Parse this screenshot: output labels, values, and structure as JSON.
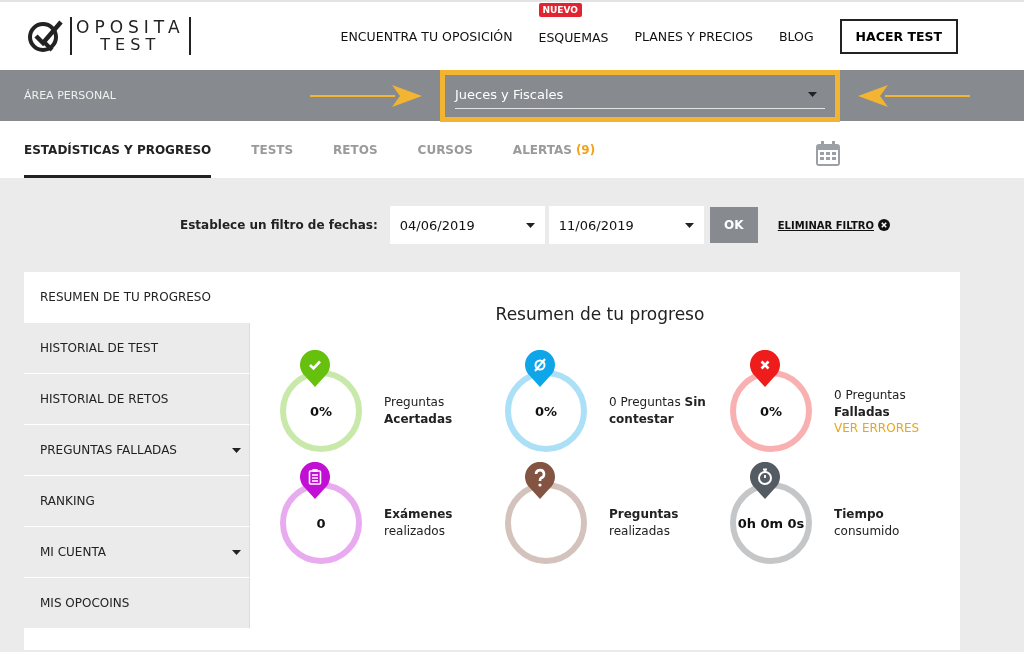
{
  "header": {
    "logo": {
      "line_1": "OPOSITA",
      "line_2": "TEST"
    },
    "nav": [
      {
        "label": "ENCUENTRA TU OPOSICIÓN"
      },
      {
        "label": "ESQUEMAS",
        "badge": "NUEVO"
      },
      {
        "label": "PLANES Y PRECIOS"
      },
      {
        "label": "BLOG"
      }
    ],
    "cta": "HACER TEST"
  },
  "area_bar": {
    "title": "ÁREA PERSONAL",
    "selector": {
      "value": "Jueces y Fiscales",
      "highlighted": true
    }
  },
  "tabs": [
    {
      "label": "ESTADÍSTICAS Y PROGRESO",
      "selected": true
    },
    {
      "label": "TESTS",
      "selected": false
    },
    {
      "label": "RETOS",
      "selected": false
    },
    {
      "label": "CURSOS",
      "selected": false
    },
    {
      "label": "ALERTAS",
      "count": "(9)",
      "selected": false
    }
  ],
  "filter": {
    "label": "Establece un filtro de fechas:",
    "from": "04/06/2019",
    "to": "11/06/2019",
    "ok": "OK",
    "clear": "ELIMINAR FILTRO"
  },
  "sidebar": {
    "items": [
      {
        "label": "RESUMEN DE TU PROGRESO",
        "selected": true,
        "has_submenu": false
      },
      {
        "label": "HISTORIAL DE TEST",
        "selected": false,
        "has_submenu": false
      },
      {
        "label": "HISTORIAL DE RETOS",
        "selected": false,
        "has_submenu": false
      },
      {
        "label": "PREGUNTAS FALLADAS",
        "selected": false,
        "has_submenu": true
      },
      {
        "label": "RANKING",
        "selected": false,
        "has_submenu": false
      },
      {
        "label": "MI CUENTA",
        "selected": false,
        "has_submenu": true
      },
      {
        "label": "MIS OPOCOINS",
        "selected": false,
        "has_submenu": false
      }
    ]
  },
  "summary": {
    "title": "Resumen de tu progreso",
    "stats": [
      {
        "kind": "check",
        "color": "#66c10f",
        "value": "0%",
        "text": "Preguntas **Acertadas**"
      },
      {
        "kind": "empty-set",
        "color": "#0ea5e9",
        "value": "0%",
        "text": "0 Preguntas **Sin contestar**"
      },
      {
        "kind": "cross",
        "color": "#ef1c1c",
        "value": "0%",
        "text": "0 Preguntas **Falladas**",
        "link": "VER ERRORES"
      },
      {
        "kind": "clipboard",
        "color": "#c10fd3",
        "value": "0",
        "text": "**Exámenes** realizados"
      },
      {
        "kind": "question",
        "color": "#845443",
        "text": "**Preguntas** realizadas"
      },
      {
        "kind": "stopwatch",
        "color": "#555b63",
        "value": "0h 0m 0s",
        "text": "**Tiempo** consumido"
      }
    ]
  }
}
